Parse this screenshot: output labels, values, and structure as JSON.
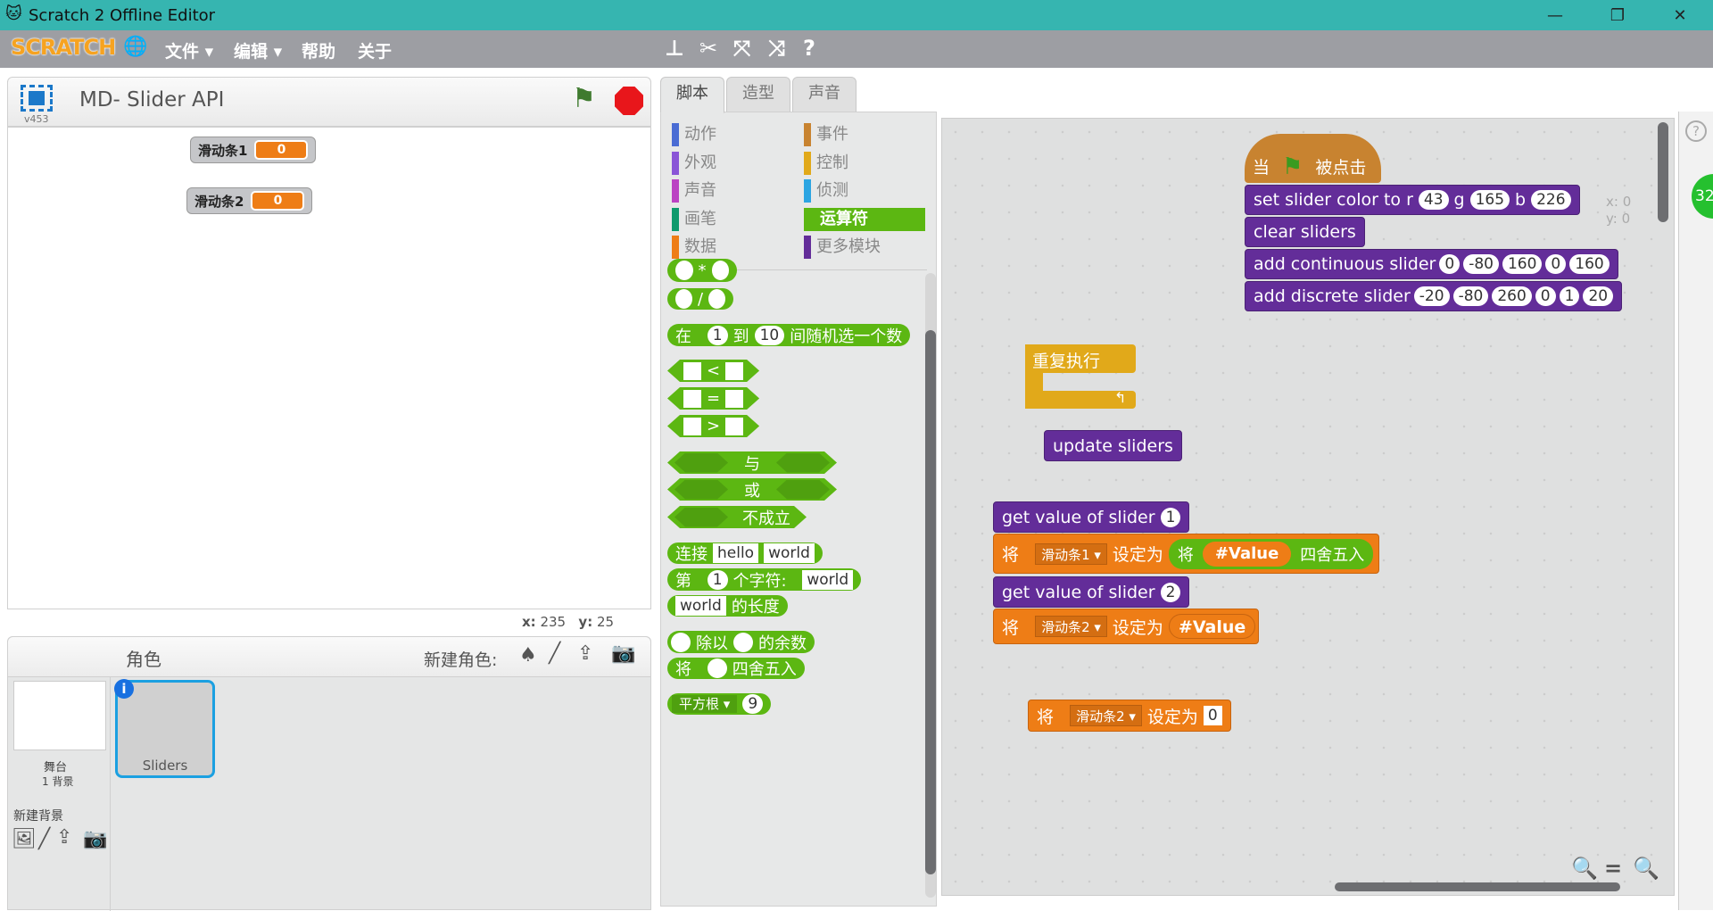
{
  "window": {
    "title": "Scratch 2 Offline Editor",
    "minimize": "—",
    "restore": "❐",
    "close": "✕"
  },
  "menu": {
    "logo": "SCRATCH",
    "file": "文件 ▾",
    "edit": "编辑 ▾",
    "help": "帮助",
    "about": "关于"
  },
  "stage": {
    "project_title": "MD- Slider API",
    "version": "v453",
    "monitors": [
      {
        "label": "滑动条1",
        "value": "0"
      },
      {
        "label": "滑动条2",
        "value": "0"
      }
    ],
    "x_label": "x:",
    "x": "235",
    "y_label": "y:",
    "y": "25"
  },
  "sprites": {
    "header": "角色",
    "new_sprite": "新建角色:",
    "stage_label": "舞台",
    "backdrops": "1 背景",
    "new_backdrop": "新建背景",
    "items": [
      {
        "name": "Sliders"
      }
    ]
  },
  "tabs": [
    {
      "label": "脚本"
    },
    {
      "label": "造型"
    },
    {
      "label": "声音"
    }
  ],
  "categories": [
    {
      "label": "动作",
      "color": "#4a6cd4"
    },
    {
      "label": "外观",
      "color": "#8a55d7"
    },
    {
      "label": "声音",
      "color": "#bb42c3"
    },
    {
      "label": "画笔",
      "color": "#0e9a6c"
    },
    {
      "label": "数据",
      "color": "#ee7d16"
    },
    {
      "label": "事件",
      "color": "#c88330"
    },
    {
      "label": "控制",
      "color": "#e1a91a"
    },
    {
      "label": "侦测",
      "color": "#2ca5e2"
    },
    {
      "label": "运算符",
      "color": "#5cb712"
    },
    {
      "label": "更多模块",
      "color": "#632d99"
    }
  ],
  "palette": {
    "mul": "*",
    "div": "/",
    "rand": [
      "在",
      "1",
      "到",
      "10",
      "间随机选一个数"
    ],
    "lt": "<",
    "eq": "=",
    "gt": ">",
    "and": "与",
    "or": "或",
    "not": "不成立",
    "join": [
      "连接",
      "hello",
      "world"
    ],
    "letter": [
      "第",
      "1",
      "个字符:",
      "world"
    ],
    "length": [
      "world",
      "的长度"
    ],
    "mod": [
      "除以",
      "的余数"
    ],
    "round": [
      "将",
      "四舍五入"
    ],
    "sqrt": [
      "平方根 ▾",
      "9"
    ]
  },
  "script": {
    "hat": [
      "当",
      "被点击"
    ],
    "set_color": [
      "set slider color to r",
      "43",
      "g",
      "165",
      "b",
      "226"
    ],
    "clear": "clear sliders",
    "add_cont": [
      "add continuous slider",
      "0",
      "-80",
      "160",
      "0",
      "160"
    ],
    "add_disc": [
      "add discrete slider",
      "-20",
      "-80",
      "260",
      "0",
      "1",
      "20"
    ],
    "forever": "重复执行",
    "update": "update sliders",
    "get1": [
      "get value of slider",
      "1"
    ],
    "set1": [
      "将",
      "滑动条1 ▾",
      "设定为",
      "将",
      "#Value",
      "四舍五入"
    ],
    "get2": [
      "get value of slider",
      "2"
    ],
    "set2": [
      "将",
      "滑动条2 ▾",
      "设定为",
      "#Value"
    ],
    "set3": [
      "将",
      "滑动条2 ▾",
      "设定为",
      "0"
    ],
    "xy": [
      "x: 0",
      "y: 0"
    ],
    "badge": "32"
  }
}
